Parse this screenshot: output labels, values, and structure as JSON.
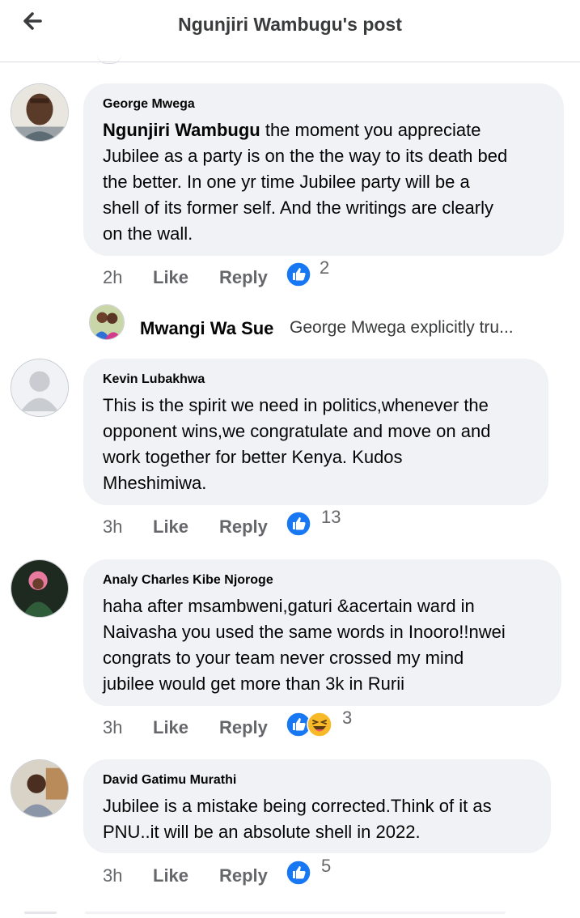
{
  "header": {
    "title": "Ngunjiri Wambugu's post"
  },
  "comments": [
    {
      "author": "George Mwega",
      "mention": "Ngunjiri Wambugu",
      "lines": [
        " the moment you appreciate",
        "Jubilee as a party is on the the way to its death bed",
        "the better. In one yr time Jubilee party will be a",
        "shell of its former self. And the writings are clearly",
        "on the wall."
      ],
      "time": "2h",
      "like": "Like",
      "reply": "Reply",
      "reactions": [
        "like"
      ],
      "count": "2"
    },
    {
      "author": "Kevin Lubakhwa",
      "lines": [
        "This is the spirit we need in politics,whenever the",
        "opponent wins,we congratulate and move on and",
        "work together for better Kenya. Kudos",
        "Mheshimiwa."
      ],
      "time": "3h",
      "like": "Like",
      "reply": "Reply",
      "reactions": [
        "like"
      ],
      "count": "13"
    },
    {
      "author": "Analy Charles Kibe Njoroge",
      "lines": [
        "haha after msambweni,gaturi &acertain ward in",
        "Naivasha you used the same words in Inooro!!nwei",
        "congrats to your team never crossed my mind",
        "jubilee would get more than 3k in Rurii"
      ],
      "time": "3h",
      "like": "Like",
      "reply": "Reply",
      "reactions": [
        "like",
        "haha"
      ],
      "count": "3"
    },
    {
      "author": "David Gatimu Murathi",
      "lines": [
        "Jubilee is a mistake being corrected.Think of it as",
        "PNU..it will be an absolute shell in 2022."
      ],
      "time": "3h",
      "like": "Like",
      "reply": "Reply",
      "reactions": [
        "like"
      ],
      "count": "5"
    }
  ],
  "reply_preview": {
    "author": "Mwangi Wa Sue",
    "text": "George Mwega explicitly tru..."
  },
  "colors": {
    "like_blue": "#1877f2",
    "haha_yellow": "#f7b928",
    "bubble": "#f0f2f5",
    "meta": "#65676b"
  },
  "icons": {
    "back": "arrow-left-icon",
    "like": "like-reaction-icon",
    "haha": "haha-reaction-icon"
  }
}
